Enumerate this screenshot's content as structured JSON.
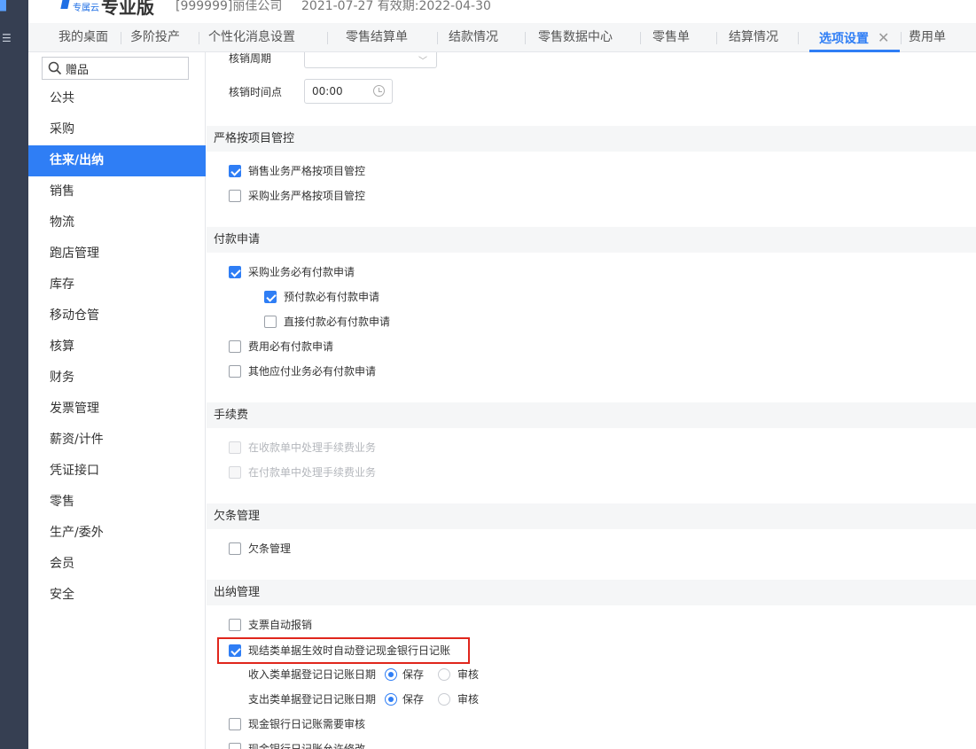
{
  "topbar": {
    "brand_sub": "专属云",
    "brand_name": "专业版",
    "company": "[999999]丽佳公司",
    "dates": "2021-07-27  有效期:2022-04-30"
  },
  "tabs": [
    {
      "label": "我的桌面"
    },
    {
      "label": "多阶投产"
    },
    {
      "label": "个性化消息设置"
    },
    {
      "label": "零售结算单"
    },
    {
      "label": "结款情况"
    },
    {
      "label": "零售数据中心"
    },
    {
      "label": "零售单"
    },
    {
      "label": "结算情况"
    },
    {
      "label": "选项设置",
      "active": true
    },
    {
      "label": "费用单"
    }
  ],
  "sidebar": {
    "search_value": "赠品",
    "items": [
      {
        "label": "公共"
      },
      {
        "label": "采购"
      },
      {
        "label": "往来/出纳",
        "active": true
      },
      {
        "label": "销售"
      },
      {
        "label": "物流"
      },
      {
        "label": "跑店管理"
      },
      {
        "label": "库存"
      },
      {
        "label": "移动仓管"
      },
      {
        "label": "核算"
      },
      {
        "label": "财务"
      },
      {
        "label": "发票管理"
      },
      {
        "label": "薪资/计件"
      },
      {
        "label": "凭证接口"
      },
      {
        "label": "零售"
      },
      {
        "label": "生产/委外"
      },
      {
        "label": "会员"
      },
      {
        "label": "安全"
      }
    ]
  },
  "content": {
    "writeoff_cycle_label": "核销周期",
    "writeoff_time_label": "核销时间点",
    "writeoff_time_value": "00:00",
    "sections": {
      "project": {
        "title": "严格按项目管控",
        "opt1": "销售业务严格按项目管控",
        "opt2": "采购业务严格按项目管控"
      },
      "payment": {
        "title": "付款申请",
        "opt1": "采购业务必有付款申请",
        "opt1a": "预付款必有付款申请",
        "opt1b": "直接付款必有付款申请",
        "opt2": "费用必有付款申请",
        "opt3": "其他应付业务必有付款申请"
      },
      "fee": {
        "title": "手续费",
        "opt1": "在收款单中处理手续费业务",
        "opt2": "在付款单中处理手续费业务"
      },
      "iou": {
        "title": "欠条管理",
        "opt1": "欠条管理"
      },
      "cashier": {
        "title": "出纳管理",
        "opt1": "支票自动报销",
        "opt2": "现结类单据生效时自动登记现金银行日记账",
        "income_label": "收入类单据登记日记账日期",
        "expense_label": "支出类单据登记日记账日期",
        "radio_save": "保存",
        "radio_audit": "审核",
        "opt3": "现金银行日记账需要审核",
        "opt4": "现金银行日记账允许修改"
      }
    }
  }
}
